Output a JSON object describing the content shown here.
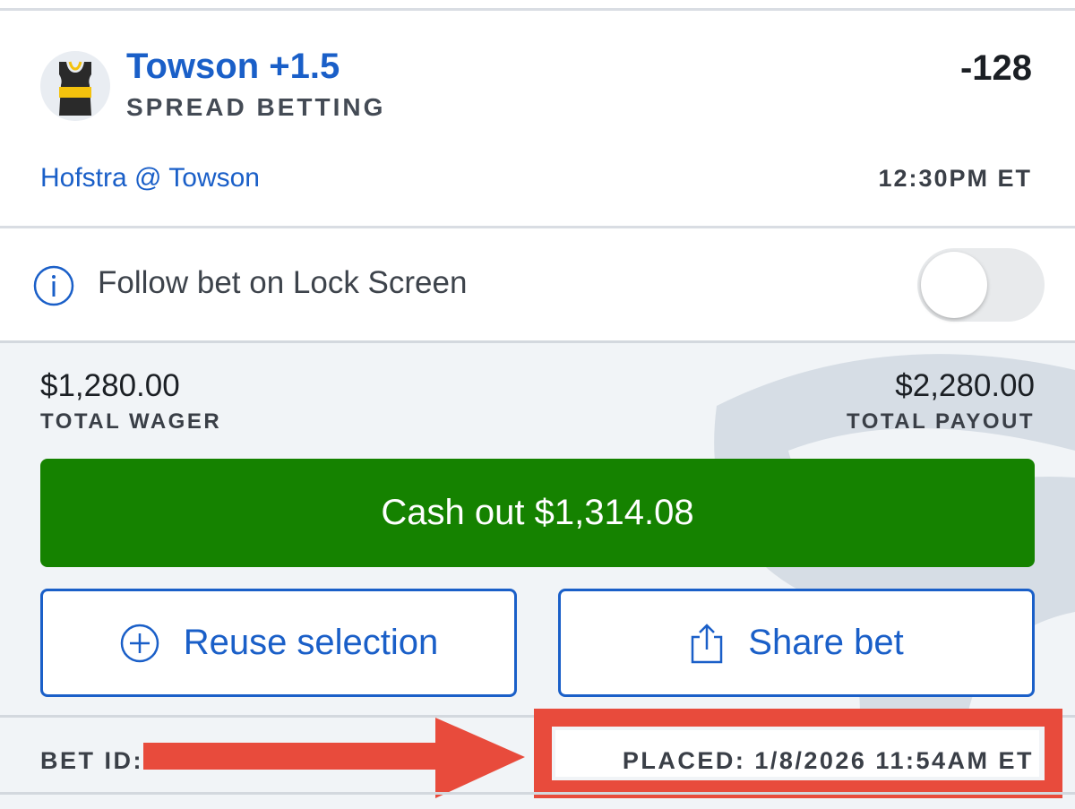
{
  "bet": {
    "selection": "Towson +1.5",
    "market": "SPREAD BETTING",
    "odds": "-128",
    "event": "Hofstra @ Towson",
    "time": "12:30PM ET"
  },
  "lock_screen": {
    "label": "Follow bet on Lock Screen",
    "enabled": false
  },
  "wager": {
    "amount": "$1,280.00",
    "label": "TOTAL WAGER"
  },
  "payout": {
    "amount": "$2,280.00",
    "label": "TOTAL PAYOUT"
  },
  "actions": {
    "cashout": "Cash out $1,314.08",
    "reuse": "Reuse selection",
    "share": "Share bet"
  },
  "footer": {
    "bet_id_label": "BET ID: C",
    "placed": "PLACED: 1/8/2026 11:54AM ET"
  },
  "colors": {
    "brand_blue": "#1a5fc8",
    "cashout_green": "#158200",
    "annotation_red": "#e84b3c"
  },
  "icons": {
    "team": "jersey-icon",
    "info": "info-icon",
    "reuse": "plus-circle-icon",
    "share": "share-icon"
  }
}
